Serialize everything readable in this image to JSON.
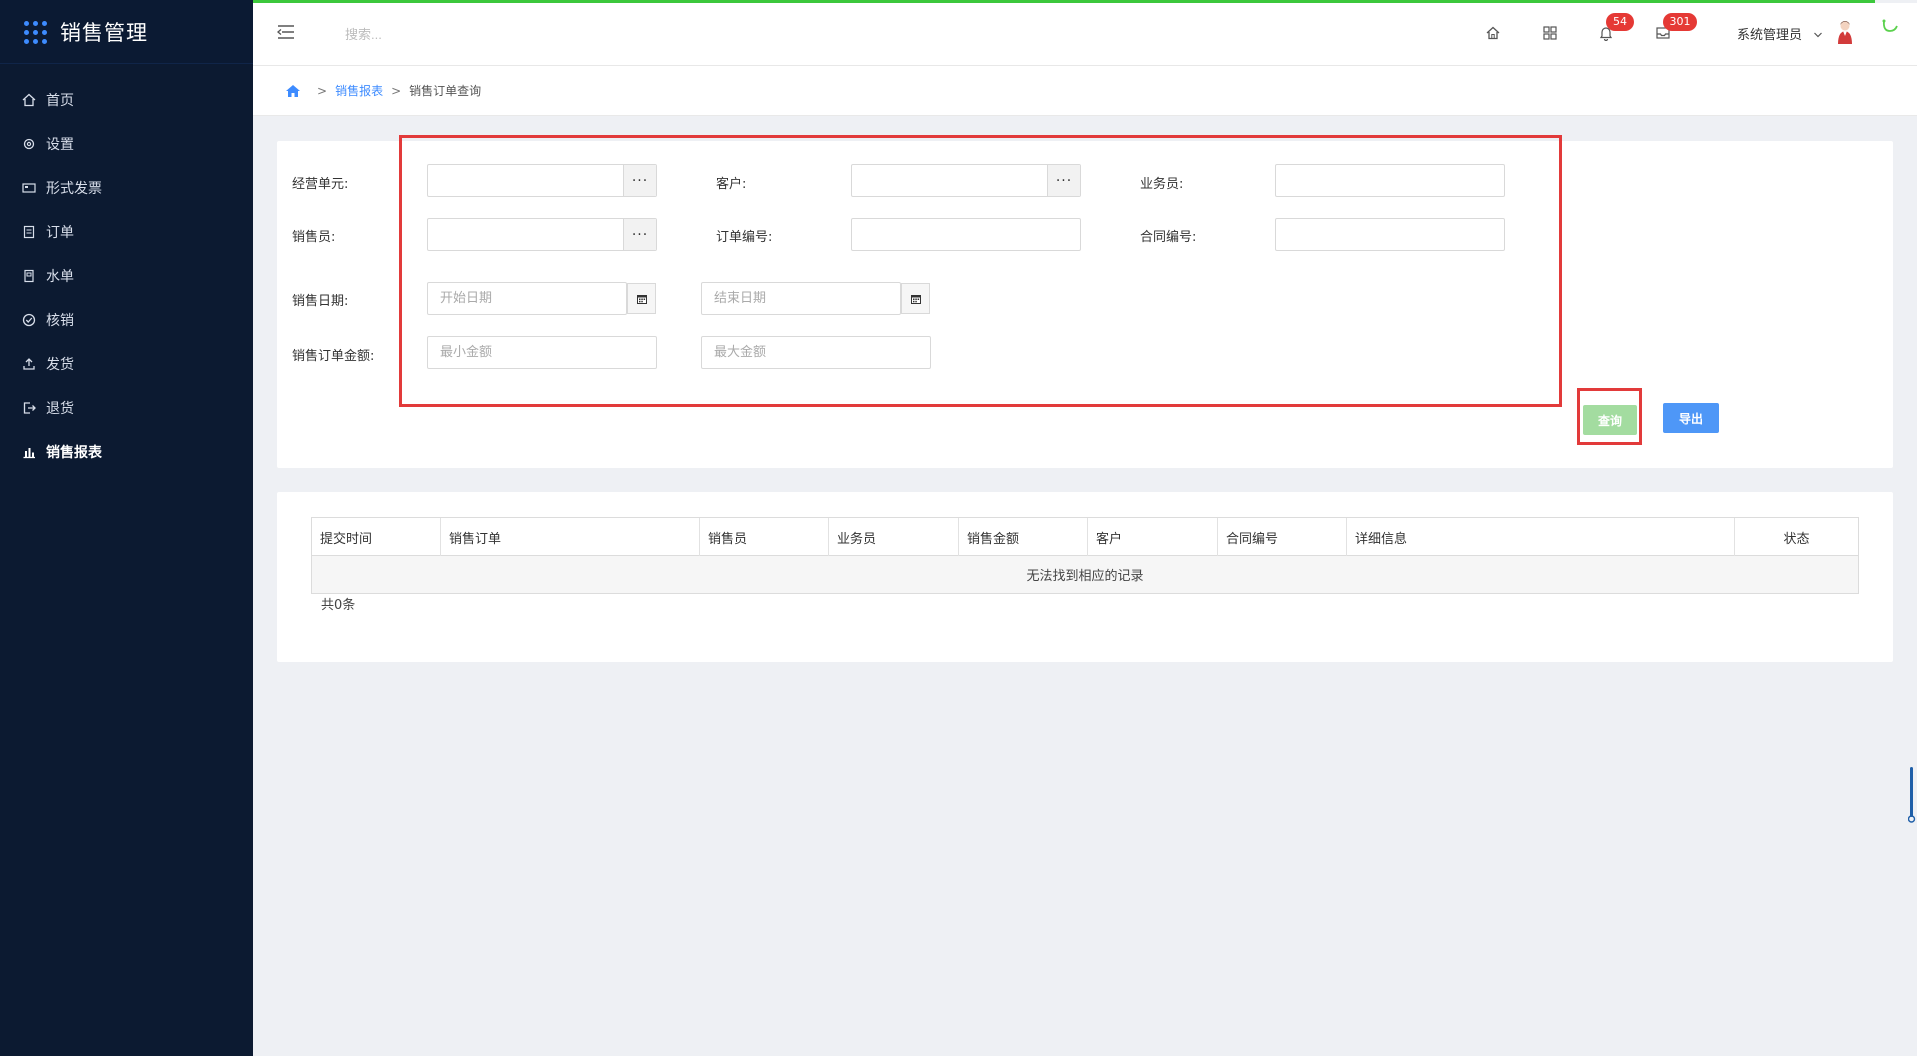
{
  "app": {
    "title": "销售管理"
  },
  "sidebar": {
    "items": [
      {
        "label": "首页",
        "icon": "home-icon"
      },
      {
        "label": "设置",
        "icon": "gear-icon"
      },
      {
        "label": "形式发票",
        "icon": "invoice-icon"
      },
      {
        "label": "订单",
        "icon": "order-icon"
      },
      {
        "label": "水单",
        "icon": "receipt-icon"
      },
      {
        "label": "核销",
        "icon": "check-circle-icon"
      },
      {
        "label": "发货",
        "icon": "upload-icon"
      },
      {
        "label": "退货",
        "icon": "return-icon"
      },
      {
        "label": "销售报表",
        "icon": "bar-chart-icon"
      }
    ],
    "active_index": 8
  },
  "header": {
    "search_placeholder": "搜索...",
    "notifications_badge": "54",
    "messages_badge": "301",
    "user_name": "系统管理员"
  },
  "breadcrumb": {
    "level1": "销售报表",
    "level2": "销售订单查询"
  },
  "filters": {
    "business_unit_label": "经营单元:",
    "customer_label": "客户:",
    "salesman_label": "业务员:",
    "seller_label": "销售员:",
    "order_no_label": "订单编号:",
    "contract_no_label": "合同编号:",
    "sale_date_label": "销售日期:",
    "start_date_placeholder": "开始日期",
    "end_date_placeholder": "结束日期",
    "amount_label": "销售订单金额:",
    "min_amount_placeholder": "最小金额",
    "max_amount_placeholder": "最大金额",
    "dots": "···"
  },
  "actions": {
    "query_label": "查询",
    "export_label": "导出"
  },
  "table": {
    "columns": [
      "提交时间",
      "销售订单",
      "销售员",
      "业务员",
      "销售金额",
      "客户",
      "合同编号",
      "详细信息",
      "状态"
    ],
    "empty_text": "无法找到相应的记录",
    "total_text": "共0条"
  },
  "colors": {
    "sidebar_bg": "#0c1a31",
    "accent": "#3d8bff",
    "highlight": "#e23a3a",
    "query_button": "#a3dca0",
    "export_button": "#4e97f7"
  }
}
